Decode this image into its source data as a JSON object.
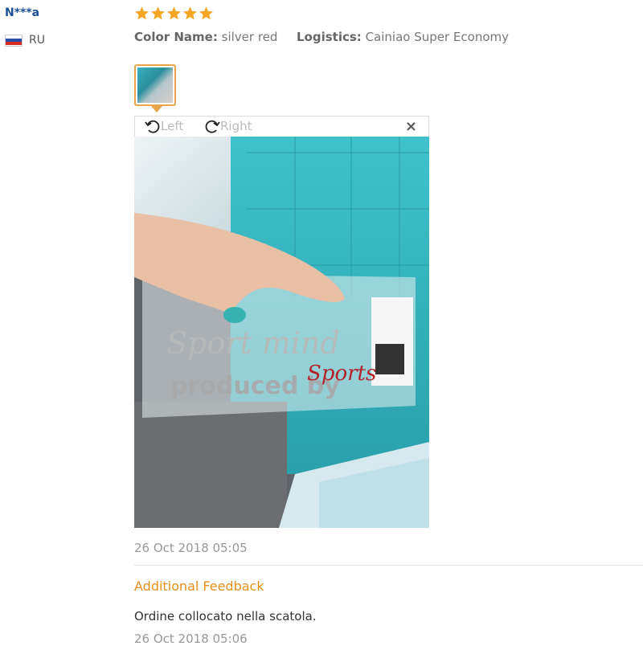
{
  "reviewer": {
    "name": "N***a",
    "country": "RU"
  },
  "rating": {
    "stars": 5,
    "color": "#f5a623"
  },
  "attributes": {
    "color_label": "Color Name:",
    "color_value": "silver red",
    "logistics_label": "Logistics:",
    "logistics_value": "Cainiao Super Economy"
  },
  "viewer": {
    "rotate_left": "Left",
    "rotate_right": "Right",
    "close": "×"
  },
  "photo": {
    "text_line1": "Sport mind",
    "text_line2": "produced by",
    "text_brand": "Sports"
  },
  "review_date": "26 Oct 2018 05:05",
  "additional": {
    "title": "Additional Feedback",
    "text": "Ordine collocato nella scatola.",
    "date": "26 Oct 2018 05:06"
  },
  "colors": {
    "accent": "#e8901b",
    "name": "#1a4f9c",
    "thumb_border": "#e8a54b"
  }
}
